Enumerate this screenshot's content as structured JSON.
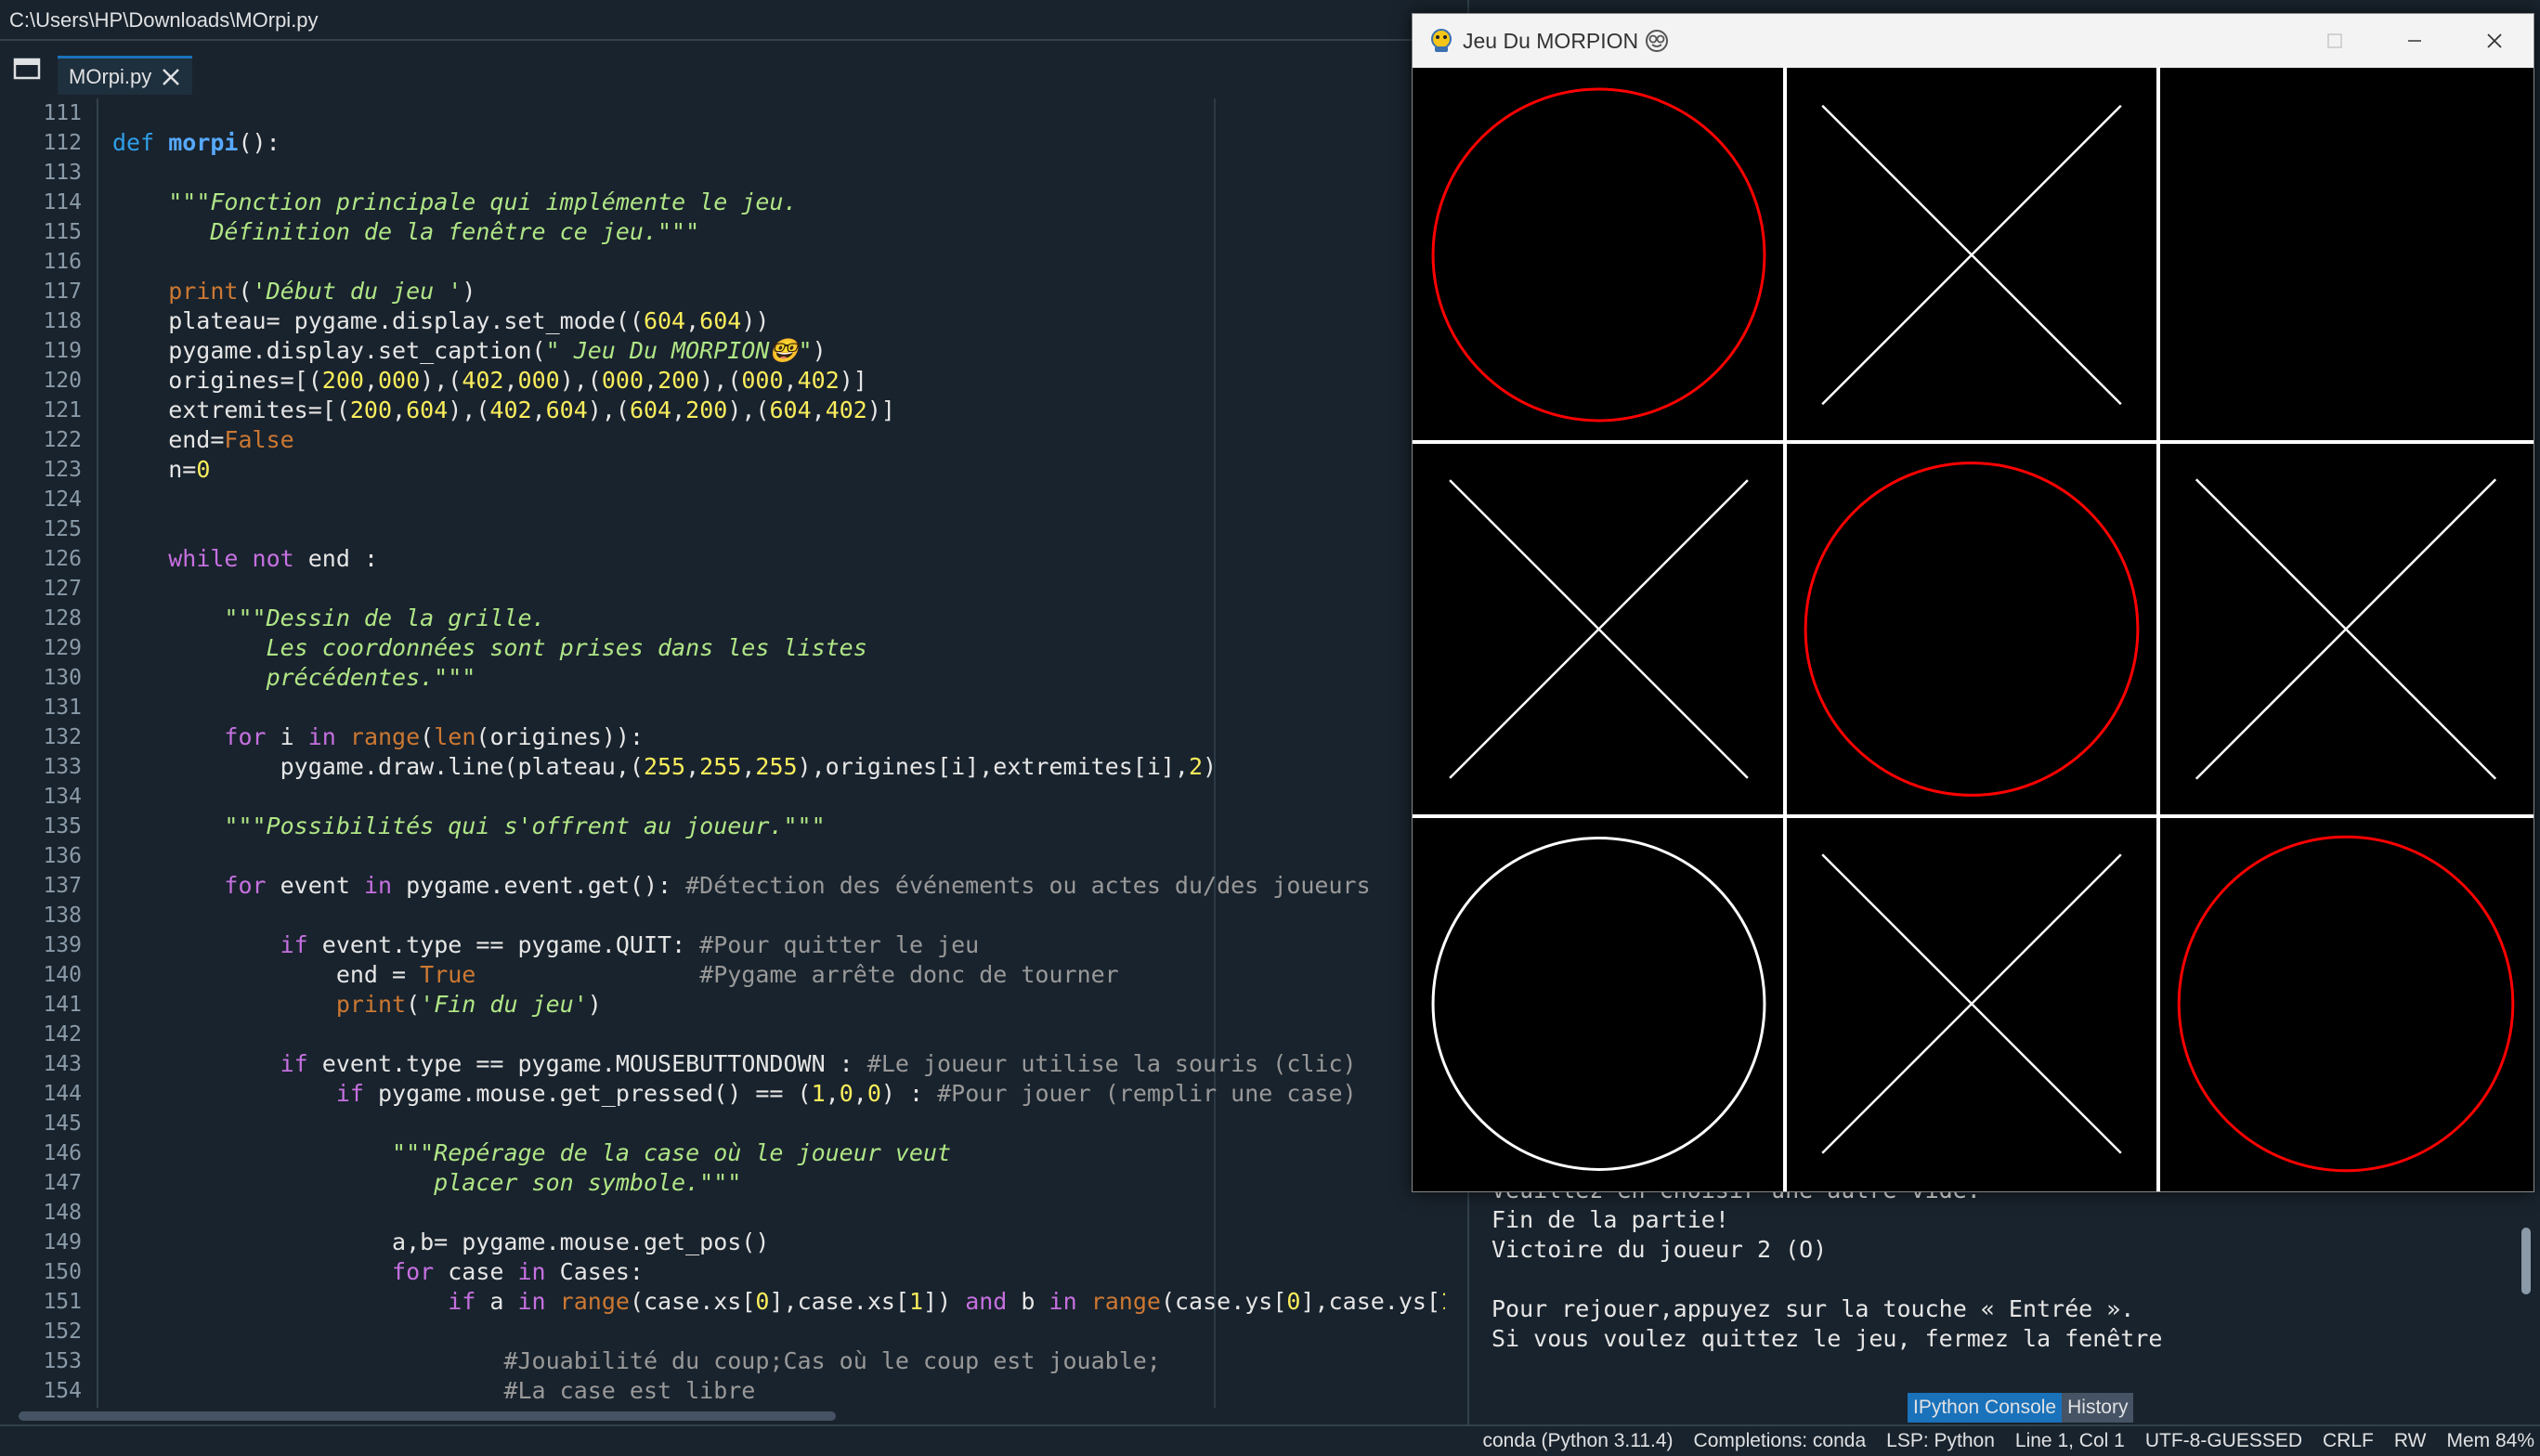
{
  "editor": {
    "file_path": "C:\\Users\\HP\\Downloads\\MOrpi.py",
    "tab_label": "MOrpi.py",
    "line_numbers": [
      "111",
      "112",
      "113",
      "114",
      "115",
      "116",
      "117",
      "118",
      "119",
      "120",
      "121",
      "122",
      "123",
      "124",
      "125",
      "126",
      "127",
      "128",
      "129",
      "130",
      "131",
      "132",
      "133",
      "134",
      "135",
      "136",
      "137",
      "138",
      "139",
      "140",
      "141",
      "142",
      "143",
      "144",
      "145",
      "146",
      "147",
      "148",
      "149",
      "150",
      "151",
      "152",
      "153",
      "154"
    ]
  },
  "console": {
    "lines": [
      "Veuillez en choisir une autre vide.",
      "Fin de la partie!",
      "Victoire du joueur 2 (O)",
      "",
      "Pour rejouer,appuyez sur la touche « Entrée ».",
      "Si vous voulez quittez le jeu, fermez la fenêtre"
    ],
    "tabs": [
      "IPython Console",
      "History"
    ]
  },
  "status_bar": {
    "items": [
      "conda (Python 3.11.4)",
      "Completions: conda",
      "LSP: Python",
      "Line 1, Col 1",
      "UTF-8-GUESSED",
      "CRLF",
      "RW",
      "Mem 84%"
    ]
  },
  "game_window": {
    "title": "Jeu Du MORPION",
    "board": [
      [
        "O-red",
        "X",
        ""
      ],
      [
        "X",
        "O-red",
        "X"
      ],
      [
        "O-white",
        "X",
        "O-red"
      ]
    ],
    "colors": {
      "grid": "#ffffff",
      "red": "#ff0000",
      "white": "#ffffff",
      "background": "#000000"
    }
  }
}
